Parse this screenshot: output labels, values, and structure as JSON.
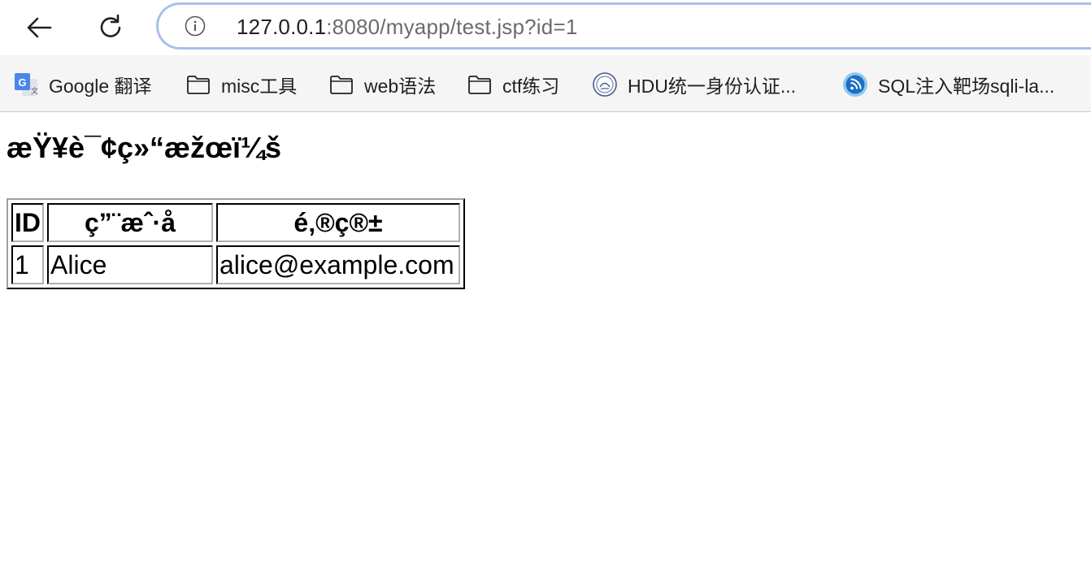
{
  "browser": {
    "url_host": "127.0.0.1",
    "url_rest": ":8080/myapp/test.jsp?id=1",
    "accent_color": "#a8c0ea"
  },
  "bookmarks": [
    {
      "label": "Google 翻译",
      "icon": "google-translate-icon"
    },
    {
      "label": "misc工具",
      "icon": "folder-icon"
    },
    {
      "label": "web语法",
      "icon": "folder-icon"
    },
    {
      "label": "ctf练习",
      "icon": "folder-icon"
    },
    {
      "label": "HDU统一身份认证...",
      "icon": "hdu-logo-icon"
    },
    {
      "label": "SQL注入靶场sqli-la...",
      "icon": "rss-icon"
    }
  ],
  "page": {
    "heading": "æŸ¥è¯¢ç»“æžœï¼š",
    "table": {
      "headers": [
        "ID",
        "ç”¨æˆ·å",
        "é‚®ç®±"
      ],
      "rows": [
        [
          "1",
          "Alice",
          "alice@example.com"
        ]
      ]
    }
  }
}
